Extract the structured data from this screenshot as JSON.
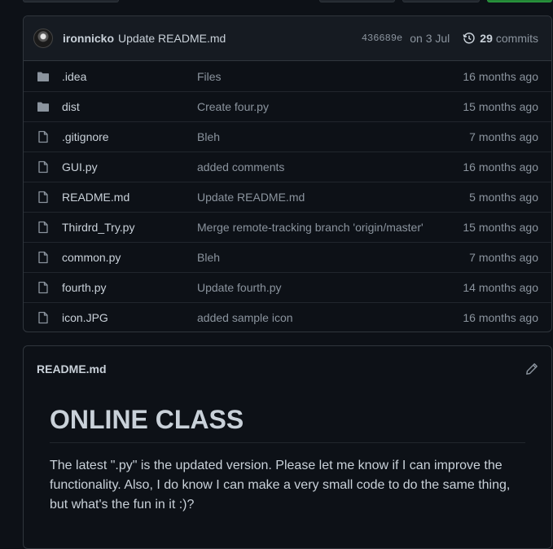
{
  "commit": {
    "author": "ironnicko",
    "message": "Update README.md",
    "sha": "436689e",
    "date": "on 3 Jul",
    "commit_count": "29",
    "commits_label": "commits"
  },
  "files": [
    {
      "name": ".idea",
      "type": "folder",
      "message": "Files",
      "age": "16 months ago"
    },
    {
      "name": "dist",
      "type": "folder",
      "message": "Create four.py",
      "age": "15 months ago"
    },
    {
      "name": ".gitignore",
      "type": "file",
      "message": "Bleh",
      "age": "7 months ago"
    },
    {
      "name": "GUI.py",
      "type": "file",
      "message": "added comments",
      "age": "16 months ago"
    },
    {
      "name": "README.md",
      "type": "file",
      "message": "Update README.md",
      "age": "5 months ago"
    },
    {
      "name": "Thirdrd_Try.py",
      "type": "file",
      "message": "Merge remote-tracking branch 'origin/master'",
      "age": "15 months ago"
    },
    {
      "name": "common.py",
      "type": "file",
      "message": "Bleh",
      "age": "7 months ago"
    },
    {
      "name": "fourth.py",
      "type": "file",
      "message": "Update fourth.py",
      "age": "14 months ago"
    },
    {
      "name": "icon.JPG",
      "type": "file",
      "message": "added sample icon",
      "age": "16 months ago"
    }
  ],
  "readme": {
    "filename": "README.md",
    "heading": "ONLINE CLASS",
    "paragraph": "The latest \".py\" is the updated version. Please let me know if I can improve the functionality. Also, I do know I can make a very small code to do the same thing, but what's the fun in it :)?"
  },
  "colors": {
    "background": "#0d1117",
    "icon": "#8b949e",
    "text": "#c9d1d9",
    "muted": "#8b949e"
  }
}
